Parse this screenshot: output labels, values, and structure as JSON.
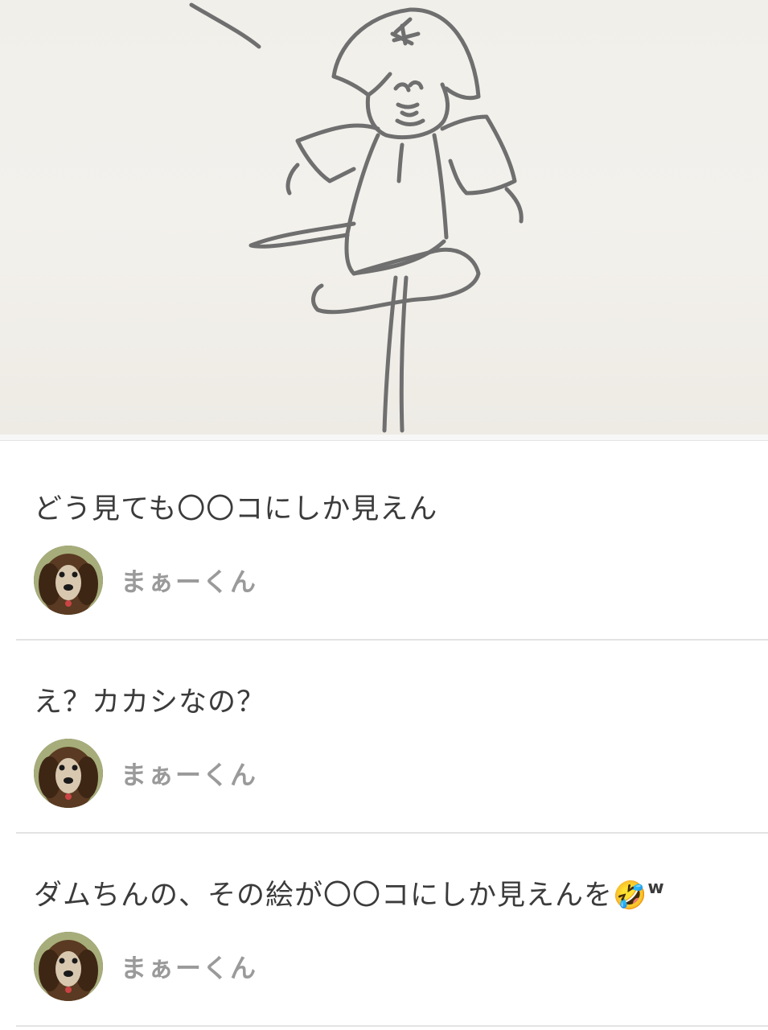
{
  "post": {
    "image_icon": "child-drawing-image"
  },
  "comments": [
    {
      "text": "どう見ても〇〇コにしか見えん",
      "author": "まぁーくん"
    },
    {
      "text": "え？カカシなの？",
      "author": "まぁーくん"
    },
    {
      "text": "ダムちんの、その絵が〇〇コにしか見えんを",
      "emoji": "🤣",
      "suffix": "w",
      "author": "まぁーくん"
    }
  ]
}
